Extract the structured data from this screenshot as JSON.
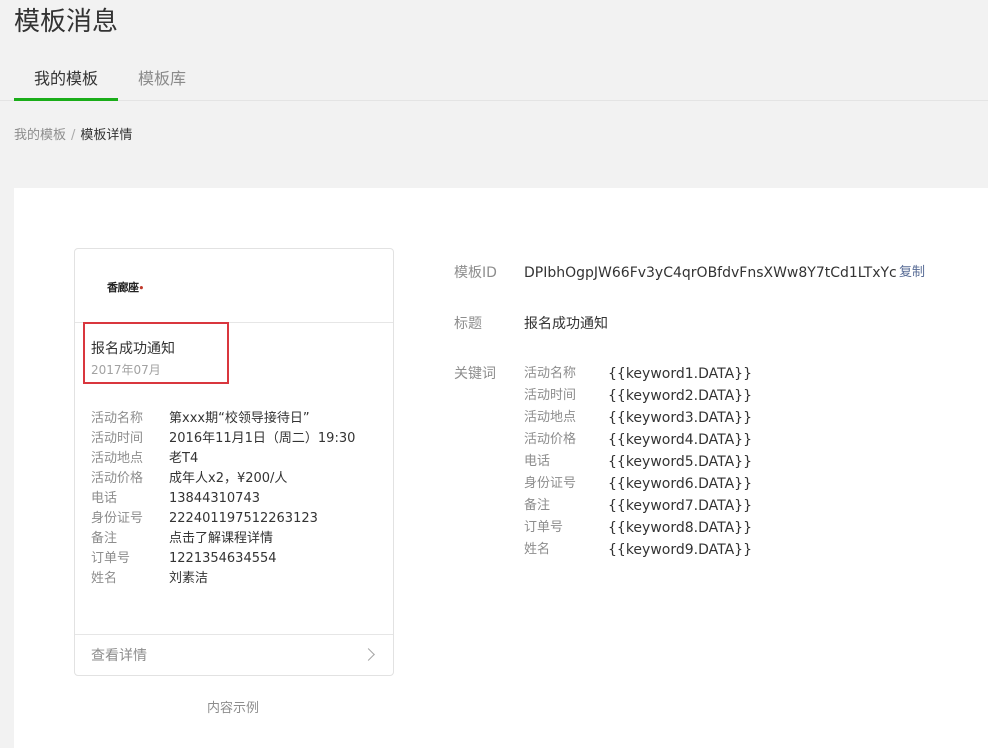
{
  "page": {
    "title": "模板消息"
  },
  "tabs": [
    {
      "label": "我的模板",
      "active": true
    },
    {
      "label": "模板库",
      "active": false
    }
  ],
  "breadcrumb": {
    "parent": "我的模板",
    "separator": "/",
    "current": "模板详情"
  },
  "card": {
    "logo_text": "香廊座",
    "title": "报名成功通知",
    "date": "2017年07月",
    "fields": [
      {
        "label": "活动名称",
        "value": "第xxx期“校领导接待日”"
      },
      {
        "label": "活动时间",
        "value": "2016年11月1日（周二）19:30"
      },
      {
        "label": "活动地点",
        "value": "老T4"
      },
      {
        "label": "活动价格",
        "value": "成年人x2，¥200/人"
      },
      {
        "label": "电话",
        "value": "13844310743"
      },
      {
        "label": "身份证号",
        "value": "222401197512263123"
      },
      {
        "label": "备注",
        "value": "点击了解课程详情"
      },
      {
        "label": "订单号",
        "value": "1221354634554"
      },
      {
        "label": "姓名",
        "value": "刘素洁"
      }
    ],
    "footer_label": "查看详情",
    "caption": "内容示例"
  },
  "info": {
    "template_id_label": "模板ID",
    "template_id": "DPIbhOgpJW66Fv3yC4qrOBfdvFnsXWw8Y7tCd1LTxYc",
    "copy_label": "复制",
    "title_label": "标题",
    "title_value": "报名成功通知",
    "keywords_label": "关键词",
    "keywords": [
      {
        "name": "活动名称",
        "value": "{{keyword1.DATA}}"
      },
      {
        "name": "活动时间",
        "value": "{{keyword2.DATA}}"
      },
      {
        "name": "活动地点",
        "value": "{{keyword3.DATA}}"
      },
      {
        "name": "活动价格",
        "value": "{{keyword4.DATA}}"
      },
      {
        "name": "电话",
        "value": "{{keyword5.DATA}}"
      },
      {
        "name": "身份证号",
        "value": "{{keyword6.DATA}}"
      },
      {
        "name": "备注",
        "value": "{{keyword7.DATA}}"
      },
      {
        "name": "订单号",
        "value": "{{keyword8.DATA}}"
      },
      {
        "name": "姓名",
        "value": "{{keyword9.DATA}}"
      }
    ]
  },
  "colors": {
    "accent_green": "#1aad19",
    "highlight_red": "#d9363e",
    "link_blue": "#576b95"
  }
}
